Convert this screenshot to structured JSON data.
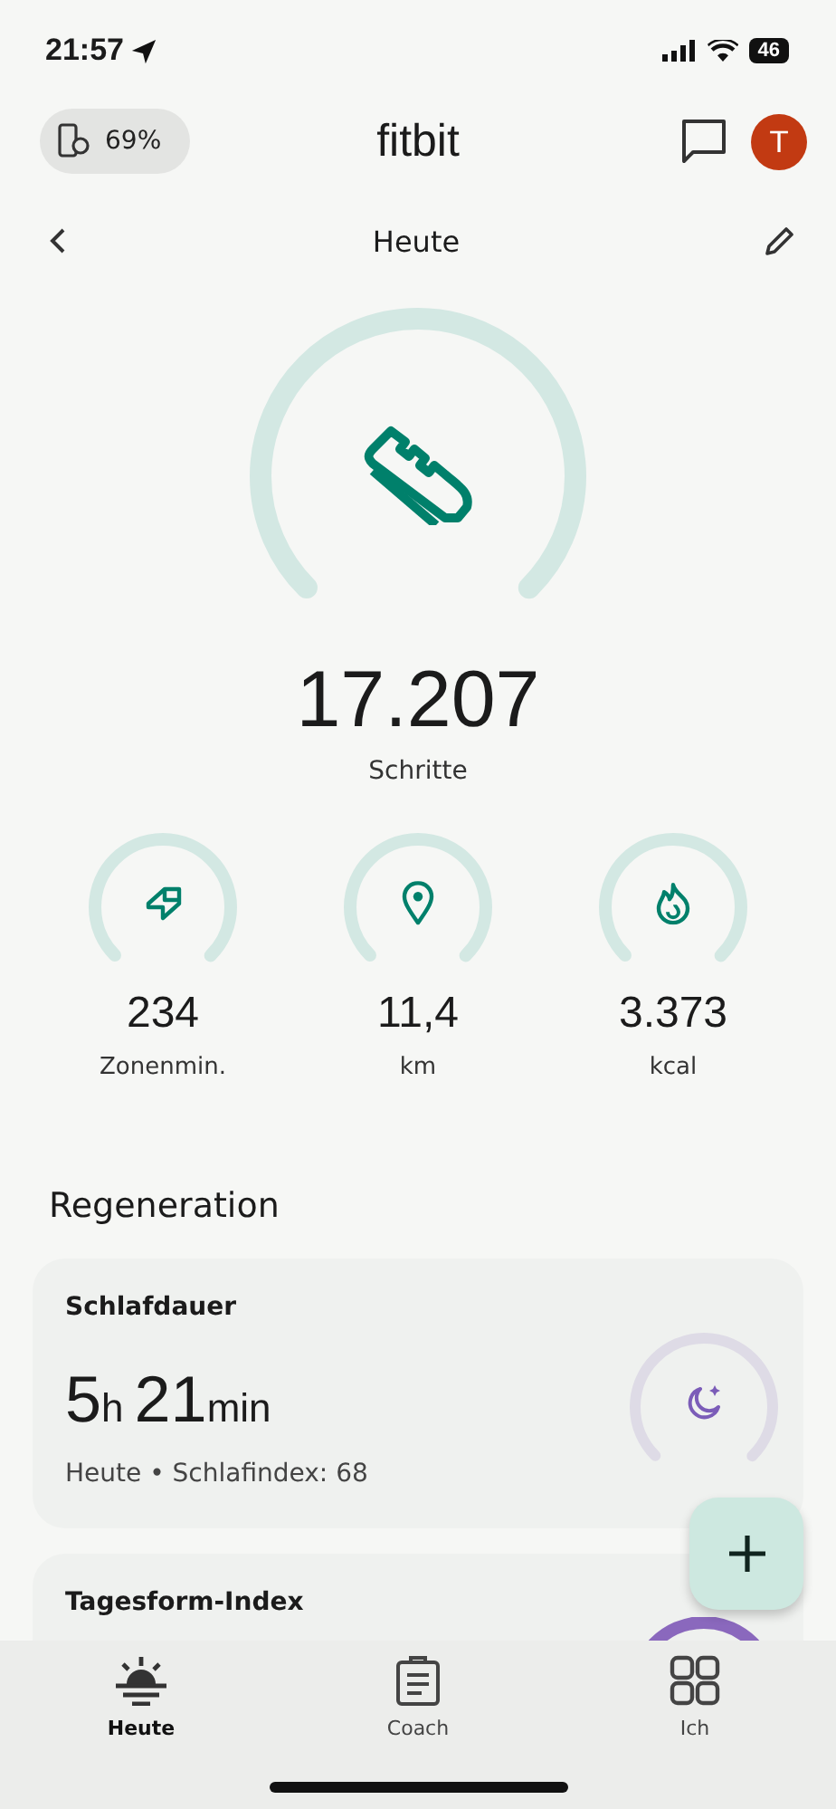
{
  "status_bar": {
    "time": "21:57",
    "battery": "46"
  },
  "header": {
    "device_battery": "69%",
    "logo": "fitbit",
    "avatar_initial": "T"
  },
  "subheader": {
    "title": "Heute"
  },
  "steps": {
    "value": "17.207",
    "label": "Schritte"
  },
  "metrics": [
    {
      "kind": "zone",
      "value": "234",
      "label": "Zonenmin."
    },
    {
      "kind": "distance",
      "value": "11,4",
      "label": "km"
    },
    {
      "kind": "calories",
      "value": "3.373",
      "label": "kcal"
    }
  ],
  "section_title": "Regeneration",
  "cards": [
    {
      "kind": "sleep",
      "title": "Schlafdauer",
      "duration": [
        {
          "value": "5",
          "unit": "h"
        },
        {
          "value": "21",
          "unit": "min"
        }
      ],
      "subtitle": "Heute • Schlafindex: 68"
    },
    {
      "kind": "readiness",
      "title": "Tagesform-Index"
    }
  ],
  "nav": [
    {
      "kind": "today",
      "label": "Heute",
      "selected": true
    },
    {
      "kind": "coach",
      "label": "Coach",
      "selected": false
    },
    {
      "kind": "me",
      "label": "Ich",
      "selected": false
    }
  ]
}
